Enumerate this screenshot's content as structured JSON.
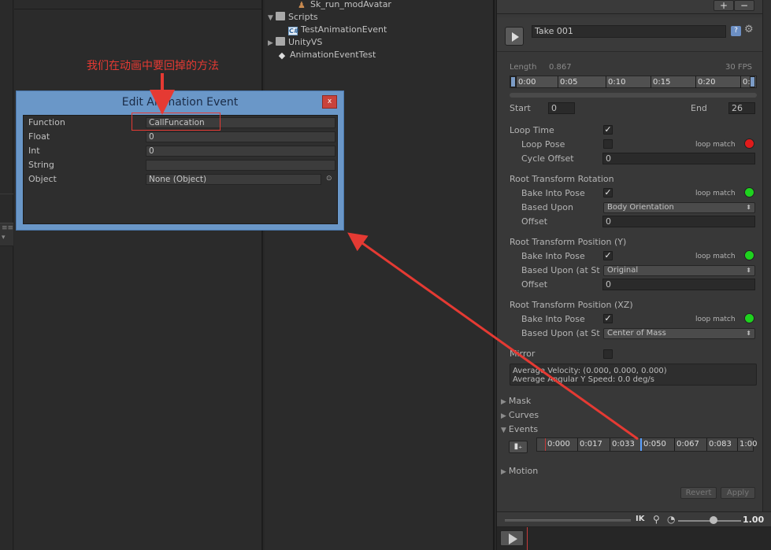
{
  "tree": {
    "items": [
      {
        "label": "Sk_run_modAvatar",
        "icon": "avatar-icon"
      },
      {
        "label": "Scripts",
        "icon": "folder-icon"
      },
      {
        "label": "TestAnimationEvent",
        "icon": "csharp-script-icon"
      },
      {
        "label": "UnityVS",
        "icon": "folder-icon"
      },
      {
        "label": "AnimationEventTest",
        "icon": "unity-scene-icon"
      }
    ]
  },
  "inspector": {
    "plus": "+",
    "minus": "−",
    "take_name": "Take 001",
    "length_label": "Length",
    "length_value": "0.867",
    "fps": "30 FPS",
    "timeline_ticks": [
      "0:00",
      "0:05",
      "0:10",
      "0:15",
      "0:20",
      "0:"
    ],
    "start_label": "Start",
    "start_value": "0",
    "end_label": "End",
    "end_value": "26",
    "loop_time": "Loop Time",
    "loop_pose": "Loop Pose",
    "loop_match": "loop match",
    "cycle_offset": "Cycle Offset",
    "cycle_offset_value": "0",
    "rot_header": "Root Transform Rotation",
    "bake_into_pose": "Bake Into Pose",
    "based_upon": "Based Upon",
    "rot_based_value": "Body Orientation",
    "offset": "Offset",
    "rot_offset_value": "0",
    "posy_header": "Root Transform Position (Y)",
    "based_upon_at": "Based Upon (at St",
    "posy_based_value": "Original",
    "posy_offset_value": "0",
    "posxz_header": "Root Transform Position (XZ)",
    "posxz_based_value": "Center of Mass",
    "mirror": "Mirror",
    "avg_velocity": "Average Velocity: (0.000, 0.000, 0.000)",
    "avg_angular": "Average Angular Y Speed: 0.0 deg/s",
    "mask": "Mask",
    "curves": "Curves",
    "events": "Events",
    "event_ticks": [
      "0:000",
      "0:017",
      "0:033",
      "0:050",
      "0:067",
      "0:083",
      "1:00"
    ],
    "motion": "Motion",
    "revert": "Revert",
    "apply": "Apply",
    "ik": "IK",
    "speed": "1.00",
    "colors": {
      "match_bad": "#e01b1b",
      "match_good": "#1ed21e"
    }
  },
  "dialog": {
    "title": "Edit Animation Event",
    "close": "x",
    "fields": [
      {
        "label": "Function",
        "value": "CallFuncation"
      },
      {
        "label": "Float",
        "value": "0"
      },
      {
        "label": "Int",
        "value": "0"
      },
      {
        "label": "String",
        "value": ""
      },
      {
        "label": "Object",
        "value": "None (Object)"
      }
    ],
    "object_picker": "⊙"
  },
  "annotation": {
    "text": "我们在动画中要回掉的方法",
    "color": "#e53a33"
  },
  "left_strip": {
    "label": "≡≡"
  }
}
